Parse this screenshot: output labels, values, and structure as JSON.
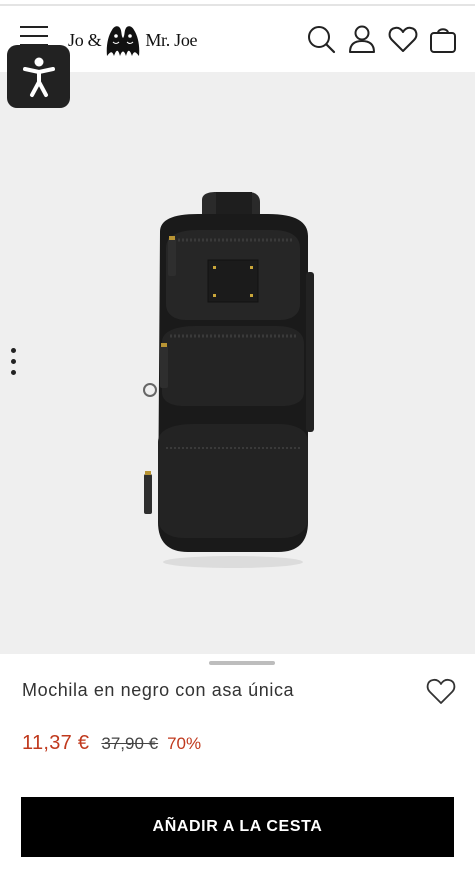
{
  "header": {
    "logo": {
      "text_left": "Jo &",
      "text_right": "Mr. Joe"
    },
    "icons": [
      "menu-icon",
      "search-icon",
      "account-icon",
      "wishlist-icon",
      "cart-icon"
    ]
  },
  "accessibility": {
    "icon": "accessibility-icon"
  },
  "gallery": {
    "image_subject": "product-image",
    "background": "#efefef"
  },
  "product": {
    "title": "Mochila en negro con asa única",
    "price_current": "11,37 €",
    "price_old": "37,90 €",
    "discount": "70%",
    "add_to_cart_label": "AÑADIR A LA CESTA"
  },
  "colors": {
    "price_accent": "#c0391d",
    "button_bg": "#000000",
    "button_text": "#ffffff"
  }
}
